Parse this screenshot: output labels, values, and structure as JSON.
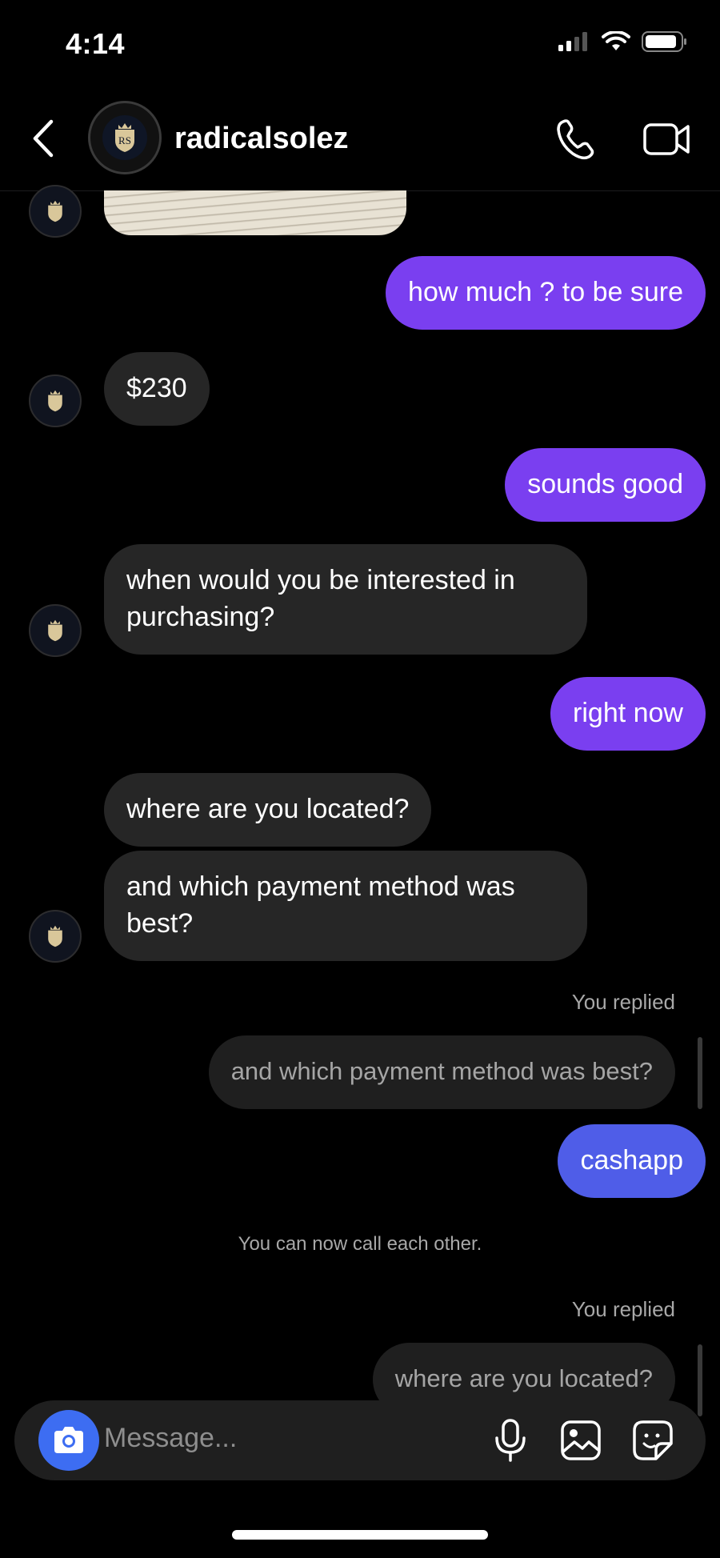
{
  "status_bar": {
    "time": "4:14"
  },
  "header": {
    "username": "radicalsolez"
  },
  "messages": {
    "m1": "how much ? to be sure",
    "m2": "$230",
    "m3": "sounds good",
    "m4_line1": "when would you be interested in",
    "m4_line2": "purchasing?",
    "m5": "right now",
    "m6": "where are you located?",
    "m7_line1": "and which payment method was",
    "m7_line2": "best?",
    "reply1_label": "You replied",
    "reply1_quote": "and which payment method was best?",
    "m8": "cashapp",
    "system_note": "You can now call each other.",
    "reply2_label": "You replied",
    "reply2_quote": "where are you located?"
  },
  "composer": {
    "placeholder": "Message..."
  },
  "colors": {
    "outgoing": "#7a3ff0",
    "outgoing_blue": "#4f5de8",
    "incoming": "#262626",
    "camera": "#3d6df2"
  },
  "icons": [
    "back-chevron-icon",
    "phone-icon",
    "video-camera-icon",
    "camera-icon",
    "microphone-icon",
    "gallery-icon",
    "sticker-icon",
    "signal-icon",
    "wifi-icon",
    "battery-icon"
  ]
}
